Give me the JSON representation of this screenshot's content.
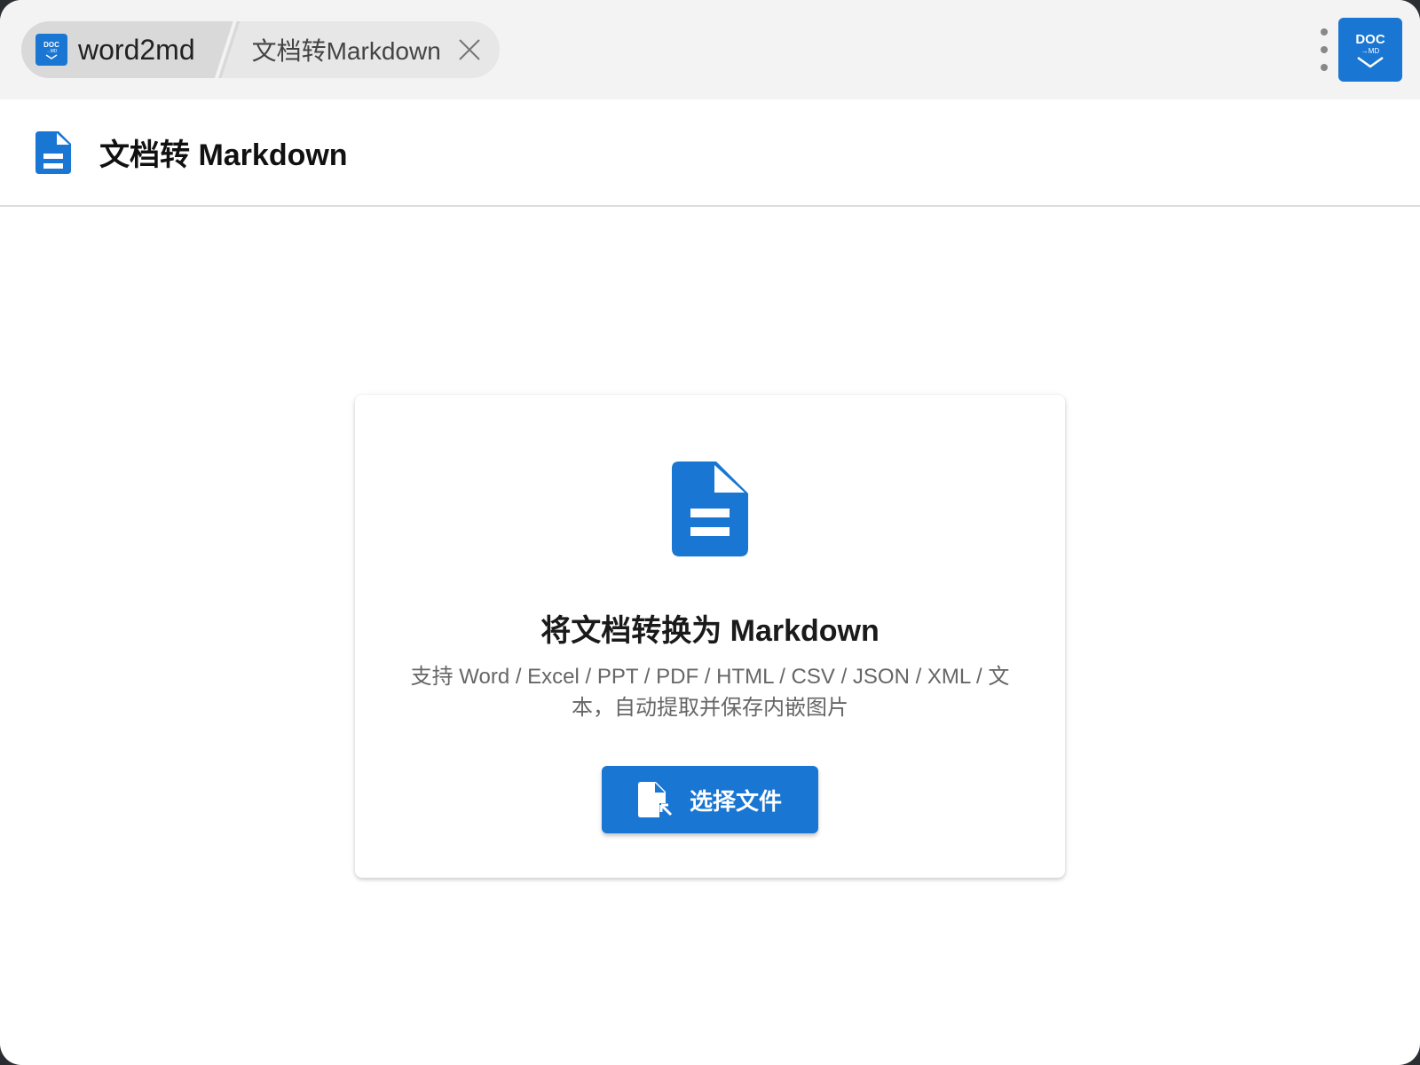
{
  "tabs": {
    "app_name": "word2md",
    "app_icon_text": "DOC",
    "app_icon_subtext": "→MD",
    "doc_tab_label": "文档转Markdown"
  },
  "corner_app": {
    "text": "DOC",
    "subtext": "→MD"
  },
  "header": {
    "title": "文档转 Markdown"
  },
  "card": {
    "title": "将文档转换为 Markdown",
    "description": "支持 Word / Excel / PPT / PDF / HTML / CSV / JSON / XML / 文本，自动提取并保存内嵌图片",
    "select_button_label": "选择文件"
  },
  "colors": {
    "accent": "#1976d2",
    "tabbar_bg": "#f3f3f3"
  },
  "icons": [
    "document-icon",
    "close-icon",
    "more-vertical-icon",
    "file-select-icon",
    "chevron-down-icon"
  ]
}
